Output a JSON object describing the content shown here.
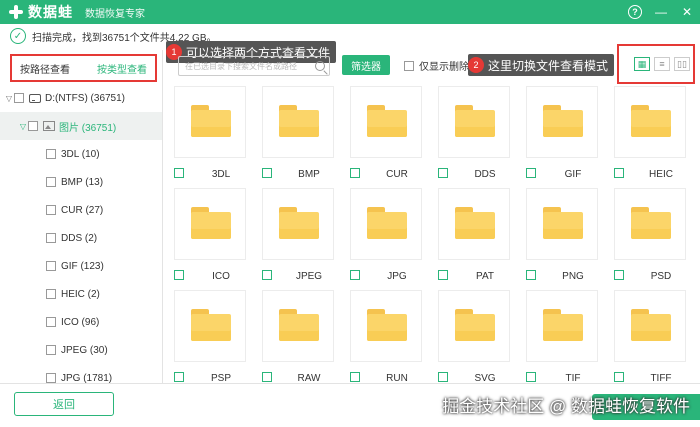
{
  "app": {
    "logo_text": "数据蛙",
    "subtitle": "数据恢复专家",
    "help": "?",
    "minimize": "—",
    "close": "✕"
  },
  "status": {
    "text": "扫描完成，找到36751个文件共4.22 GB。"
  },
  "left_panel": {
    "by_path": "按路径查看",
    "by_type": "按类型查看",
    "drive": {
      "arrow": "▽",
      "label": "D:(NTFS) (36751)"
    },
    "pictures": {
      "arrow": "▽",
      "label": "图片 (36751)"
    },
    "items": [
      {
        "label": "3DL (10)"
      },
      {
        "label": "BMP (13)"
      },
      {
        "label": "CUR (27)"
      },
      {
        "label": "DDS (2)"
      },
      {
        "label": "GIF (123)"
      },
      {
        "label": "HEIC (2)"
      },
      {
        "label": "ICO (96)"
      },
      {
        "label": "JPEG (30)"
      },
      {
        "label": "JPG (1781)"
      }
    ]
  },
  "annotations": {
    "one": {
      "num": "1",
      "text": "可以选择两个方式查看文件"
    },
    "two": {
      "num": "2",
      "text": "这里切换文件查看模式"
    }
  },
  "toolbar": {
    "search_placeholder": "在已选目录下搜索文件名或路径",
    "filter": "筛选器",
    "only_deleted": "仅显示删除项",
    "mode_icons": [
      "grid-view-icon",
      "list-view-icon",
      "preview-view-icon"
    ]
  },
  "files": [
    "3DL",
    "BMP",
    "CUR",
    "DDS",
    "GIF",
    "HEIC",
    "ICO",
    "JPEG",
    "JPG",
    "PAT",
    "PNG",
    "PSD",
    "PSP",
    "RAW",
    "RUN",
    "SVG",
    "TIF",
    "TIFF"
  ],
  "bottom": {
    "back": "返回",
    "watermark": "掘金技术社区 @ 数据蛙恢复软件"
  },
  "colors": {
    "brand": "#2ab57a",
    "annotation_red": "#e53935",
    "folder": "#fbd569"
  }
}
